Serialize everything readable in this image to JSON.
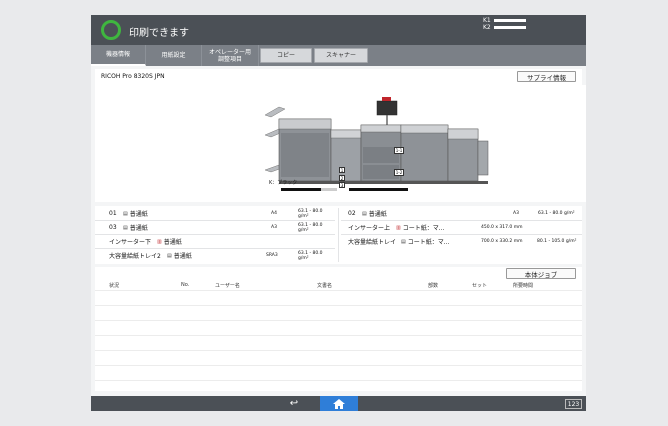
{
  "header": {
    "status_text": "印刷できます",
    "toner_k1": "K1",
    "toner_k2": "K2"
  },
  "tabs": [
    {
      "label": "機器情報"
    },
    {
      "label": "用紙設定"
    },
    {
      "label": "オペレーター用\n調整項目"
    },
    {
      "label": "コピー"
    },
    {
      "label": "スキャナー"
    }
  ],
  "printer": {
    "model": "RICOH Pro 8320S JPN",
    "supply_button": "サプライ情報",
    "toner_label": "K：ブラック",
    "tray_markers": [
      "1-1",
      "1-2",
      "1",
      "2",
      "3"
    ]
  },
  "trays": [
    {
      "num": "01",
      "type": "普通紙",
      "size": "A4",
      "weight": "63.1 - 80.0 g/m²"
    },
    {
      "num": "03",
      "type": "普通紙",
      "size": "A3",
      "weight": "63.1 - 80.0 g/m²"
    },
    {
      "num": "インサーター下",
      "type": "普通紙",
      "size": "",
      "weight": ""
    },
    {
      "num": "大容量給紙トレイ2",
      "type": "普通紙",
      "size": "SRA3",
      "weight": "63.1 - 80.0 g/m²"
    },
    {
      "num": "02",
      "type": "普通紙",
      "size": "A3",
      "weight": "63.1 - 80.0 g/m²"
    },
    {
      "num": "インサーター上",
      "type": "コート紙：マ...",
      "size": "450.0 x 317.0 mm",
      "weight": ""
    },
    {
      "num": "大容量給紙トレイ",
      "type": "コート紙：マ...",
      "size": "700.0 x 330.2 mm",
      "weight": "80.1 - 105.0 g/m²"
    }
  ],
  "jobs": {
    "button": "本体ジョブ",
    "columns": [
      "状況",
      "No.",
      "ユーザー名",
      "文書名",
      "部数",
      "セット",
      "所要時間"
    ]
  },
  "bottom": {
    "keyboard_label": "123"
  },
  "colors": {
    "header_bg": "#4b5056",
    "status_green": "#3fb63f",
    "home_blue": "#2f7ed8",
    "paper_red": "#c0252b"
  }
}
